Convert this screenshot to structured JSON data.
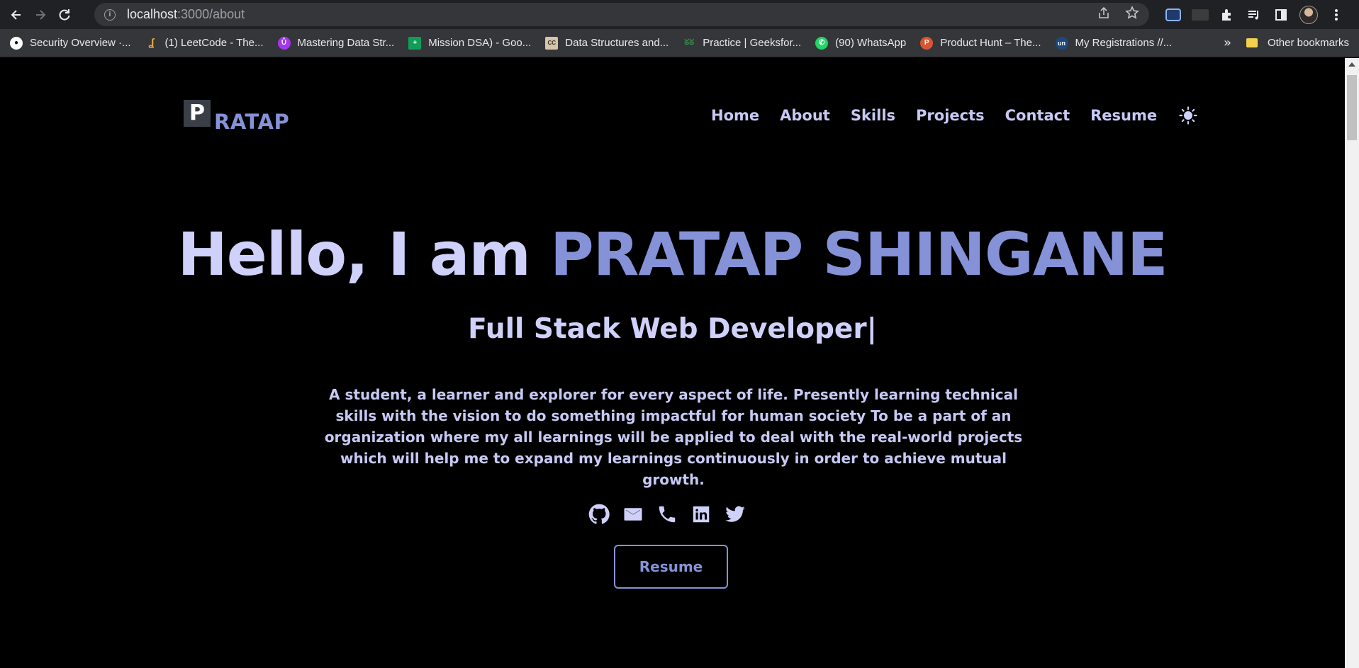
{
  "browser": {
    "url_host": "localhost",
    "url_path": ":3000/about",
    "bookmarks": [
      {
        "label": "Security Overview ·...",
        "icon": "github-icon",
        "color": "#ffffff"
      },
      {
        "label": "(1) LeetCode - The...",
        "icon": "leetcode-icon",
        "color": "#f0a53a"
      },
      {
        "label": "Mastering Data Str...",
        "icon": "udemy-icon",
        "color": "#a435f0"
      },
      {
        "label": "Mission DSA) - Goo...",
        "icon": "sheets-icon",
        "color": "#0f9d58"
      },
      {
        "label": "Data Structures and...",
        "icon": "cc-icon",
        "color": "#c4a484"
      },
      {
        "label": "Practice | Geeksfor...",
        "icon": "gfg-icon",
        "color": "#2f8d46"
      },
      {
        "label": "(90) WhatsApp",
        "icon": "whatsapp-icon",
        "color": "#25d366"
      },
      {
        "label": "Product Hunt – The...",
        "icon": "producthunt-icon",
        "color": "#da552f"
      },
      {
        "label": "My Registrations //...",
        "icon": "unstop-icon",
        "color": "#1c4980"
      }
    ],
    "more": "»",
    "other_bookmarks": "Other bookmarks"
  },
  "site": {
    "logo_letter": "P",
    "logo_text": "RATAP",
    "nav": [
      "Home",
      "About",
      "Skills",
      "Projects",
      "Contact",
      "Resume"
    ],
    "theme_icon": "sun-icon"
  },
  "hero": {
    "greeting": "Hello, I am ",
    "name": "PRATAP SHINGANE",
    "subtitle": "Full Stack Web Developer|",
    "description": "A student, a learner and explorer for every aspect of life. Presently learning technical skills with the vision to do something impactful for human society To be a part of an organization where my all learnings will be applied to deal with the real-world projects which will help me to expand my learnings continuously in order to achieve mutual growth.",
    "socials": [
      "github-icon",
      "mail-icon",
      "phone-icon",
      "linkedin-icon",
      "twitter-icon"
    ],
    "resume_button": "Resume"
  },
  "colors": {
    "accent": "#8592d8",
    "text_light": "#d0d1fb",
    "background": "#000000"
  }
}
